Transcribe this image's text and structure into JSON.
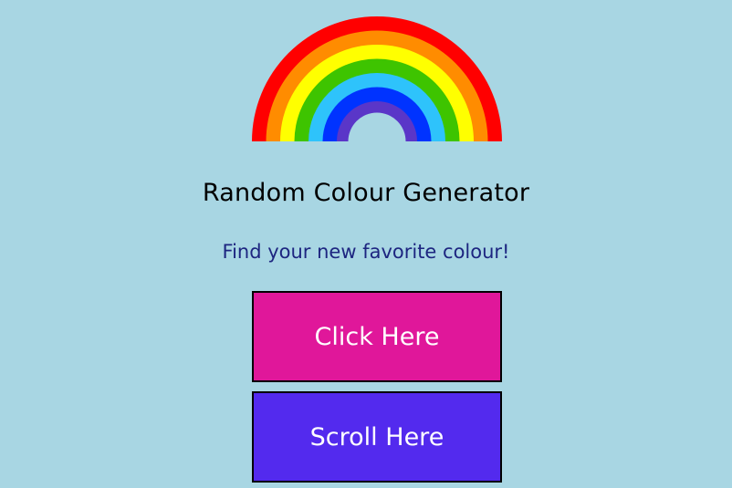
{
  "colors": {
    "background": "#a8d6e3",
    "subtitle_text": "#1d2580",
    "click_button_bg": "#e0179a",
    "scroll_button_bg": "#532aee",
    "rainbow_bands": [
      "#ff0000",
      "#ff8c00",
      "#ffff00",
      "#3ec400",
      "#2ec3fb",
      "#0033ff",
      "#5a36c8"
    ]
  },
  "header": {
    "title": "Random Colour Generator",
    "subtitle": "Find your new favorite colour!"
  },
  "buttons": {
    "click_label": "Click Here",
    "scroll_label": "Scroll Here"
  },
  "icons": {
    "rainbow": "rainbow-icon"
  }
}
